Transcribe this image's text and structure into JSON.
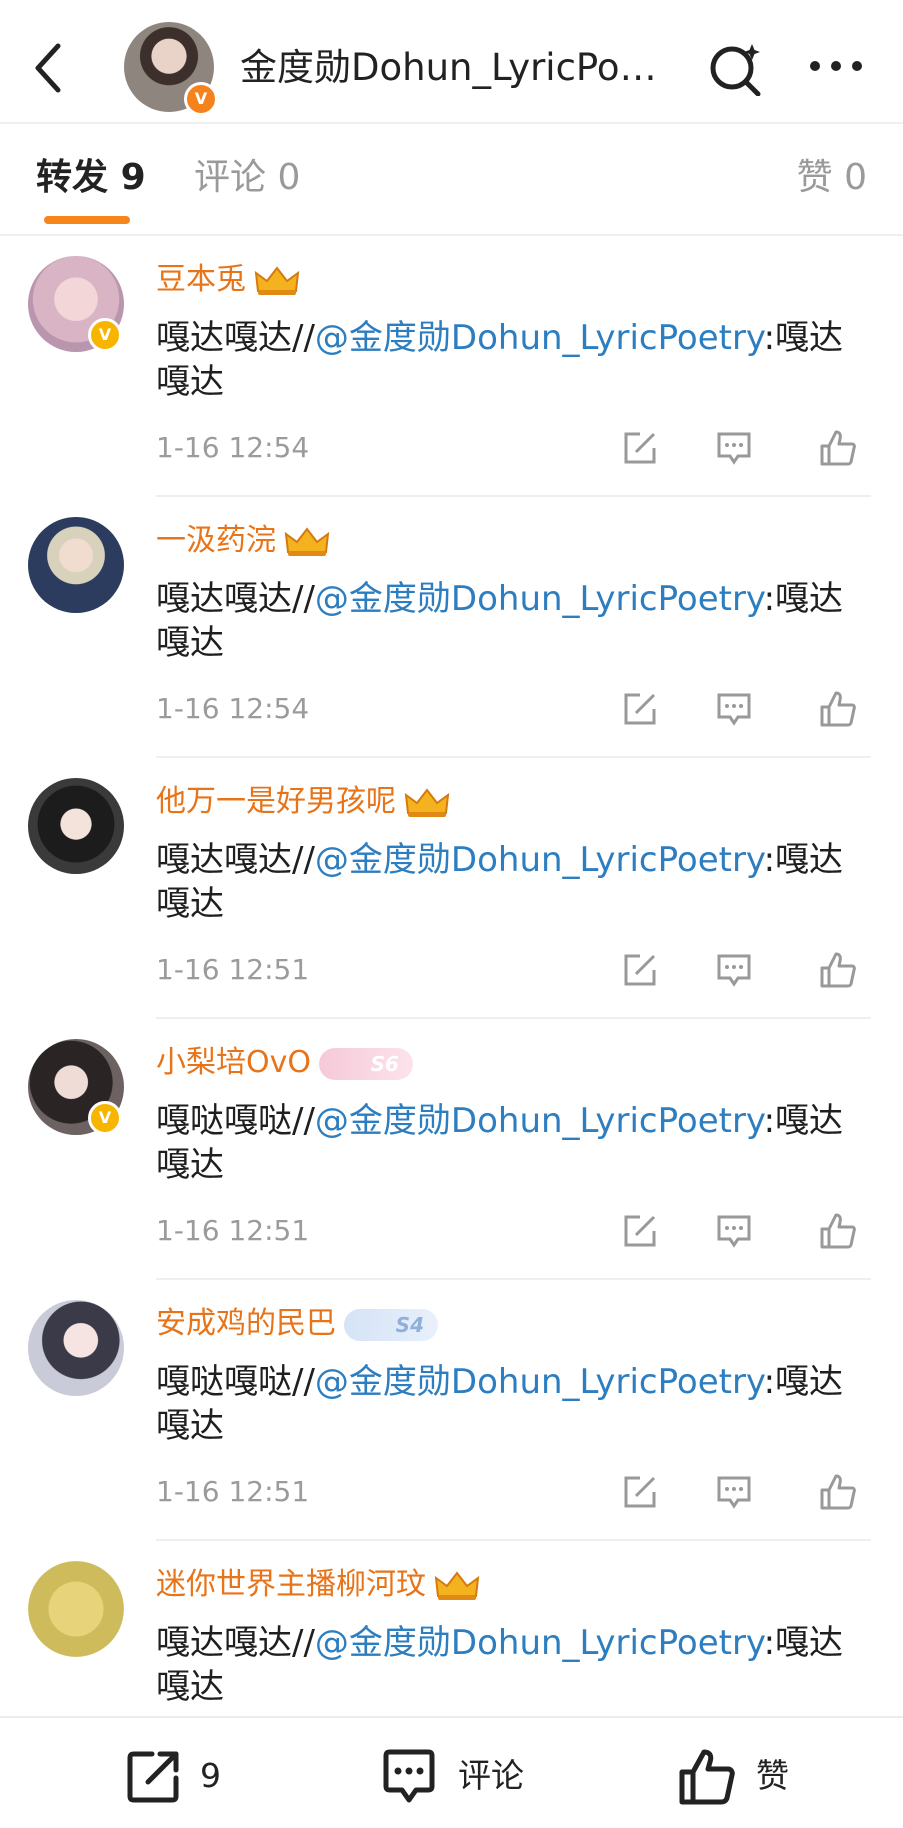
{
  "header": {
    "title": "金度勋Dohun_LyricPoetry",
    "verified_badge": "V"
  },
  "tabs": [
    {
      "label": "转发",
      "count": "9"
    },
    {
      "label": "评论",
      "count": "0"
    },
    {
      "label": "赞",
      "count": "0"
    }
  ],
  "items": [
    {
      "name": "豆本兎",
      "text_before": "嘎达嘎达//",
      "mention": "@金度勋Dohun_LyricPoetry",
      "text_after": ":嘎达嘎达",
      "time": "1-16 12:54",
      "badge": "V",
      "decoration": "crown"
    },
    {
      "name": "一汲药浣",
      "text_before": "嘎达嘎达//",
      "mention": "@金度勋Dohun_LyricPoetry",
      "text_after": ":嘎达嘎达",
      "time": "1-16 12:54",
      "badge": "",
      "decoration": "crown"
    },
    {
      "name": "他万一是好男孩呢",
      "text_before": "嘎达嘎达//",
      "mention": "@金度勋Dohun_LyricPoetry",
      "text_after": ":嘎达嘎达",
      "time": "1-16 12:51",
      "badge": "",
      "decoration": "crown"
    },
    {
      "name": "小梨培OvO",
      "text_before": "嘎哒嘎哒//",
      "mention": "@金度勋Dohun_LyricPoetry",
      "text_after": ":嘎达嘎达",
      "time": "1-16 12:51",
      "badge": "V",
      "decoration": "S6"
    },
    {
      "name": "安成鸡的民巴",
      "text_before": "嘎哒嘎哒//",
      "mention": "@金度勋Dohun_LyricPoetry",
      "text_after": ":嘎达嘎达",
      "time": "1-16 12:51",
      "badge": "",
      "decoration": "S4"
    },
    {
      "name": "迷你世界主播柳河玟",
      "text_before": "嘎达嘎达//",
      "mention": "@金度勋Dohun_LyricPoetry",
      "text_after": ":嘎达嘎达",
      "time": "",
      "badge": "",
      "decoration": "crown"
    }
  ],
  "bottom_bar": {
    "repost_count": "9",
    "comment_label": "评论",
    "like_label": "赞"
  },
  "colors": {
    "accent_orange": "#e8741a",
    "link_blue": "#2d7ec0",
    "tab_underline": "#f7861a"
  },
  "icons": [
    "back-arrow-icon",
    "search-sparkle-icon",
    "more-dots-icon",
    "repost-icon",
    "comment-icon",
    "like-icon",
    "crown-icon"
  ]
}
